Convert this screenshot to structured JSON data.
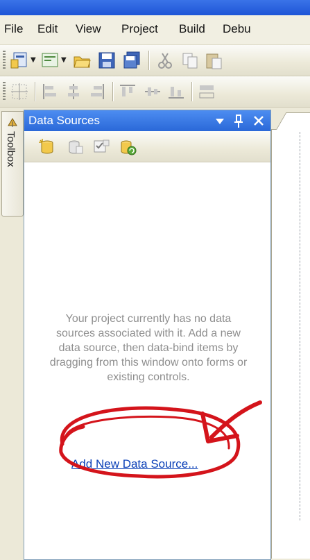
{
  "menu": {
    "items": [
      "File",
      "Edit",
      "View",
      "Project",
      "Build",
      "Debu"
    ]
  },
  "toolbox": {
    "label": "Toolbox"
  },
  "data_sources_panel": {
    "title": "Data Sources",
    "header_buttons": [
      "chevron-down-icon",
      "pin-icon",
      "close-icon"
    ],
    "toolbar_icons": [
      "add-data-source-icon",
      "edit-dataset-icon",
      "configure-icon",
      "refresh-icon"
    ],
    "empty_message": "Your project currently has no data sources associated with it. Add a new data source, then data-bind items by dragging from this window onto forms or existing controls.",
    "add_link": "Add New Data Source..."
  },
  "colors": {
    "title_bar": "#2a68d8",
    "link": "#0a3fb7",
    "annotation": "#d4141b",
    "message_text": "#8e8e8e"
  }
}
